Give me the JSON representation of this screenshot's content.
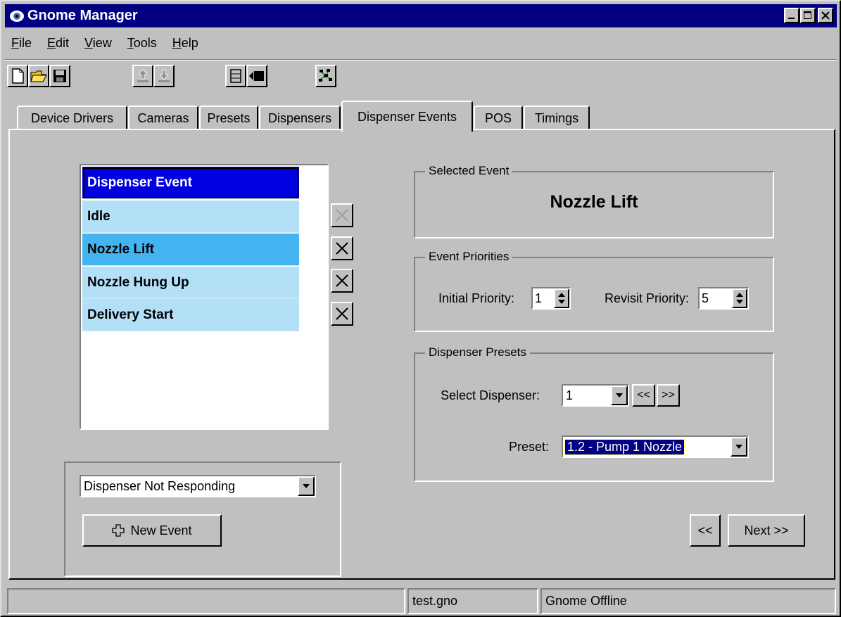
{
  "window": {
    "title": "Gnome Manager",
    "title_bar_color": "#000080"
  },
  "menu": [
    {
      "label": "File",
      "mnemonic": "F",
      "rest": "ile"
    },
    {
      "label": "Edit",
      "mnemonic": "E",
      "rest": "dit"
    },
    {
      "label": "View",
      "mnemonic": "V",
      "rest": "iew"
    },
    {
      "label": "Tools",
      "mnemonic": "T",
      "rest": "ools"
    },
    {
      "label": "Help",
      "mnemonic": "H",
      "rest": "elp"
    }
  ],
  "toolbar": {
    "icons": [
      "new-file-icon",
      "open-folder-icon",
      "save-icon",
      "upload-icon",
      "download-icon",
      "panel-icon",
      "camera-icon",
      "network-icon"
    ]
  },
  "tabs": [
    "Device Drivers",
    "Cameras",
    "Presets",
    "Dispensers",
    "Dispenser Events",
    "POS",
    "Timings"
  ],
  "active_tab": "Dispenser Events",
  "event_list": {
    "header": "Dispenser Event",
    "items": [
      "Idle",
      "Nozzle Lift",
      "Nozzle Hung Up",
      "Delivery Start"
    ],
    "selected": "Nozzle Lift",
    "colors": {
      "header": "#0000e0",
      "row": "#b4e0f7",
      "selected_row": "#44b4f0"
    }
  },
  "new_event": {
    "combo_value": "Dispenser Not Responding",
    "button_label": "New Event"
  },
  "selected_event": {
    "group_label": "Selected Event",
    "value": "Nozzle Lift"
  },
  "priorities": {
    "group_label": "Event Priorities",
    "initial_label": "Initial Priority:",
    "initial_value": "1",
    "revisit_label": "Revisit Priority:",
    "revisit_value": "5"
  },
  "presets": {
    "group_label": "Dispenser Presets",
    "dispenser_label": "Select Dispenser:",
    "dispenser_value": "1",
    "prev_label": "<<",
    "next_label": ">>",
    "preset_label": "Preset:",
    "preset_value": "1.2 - Pump 1 Nozzle"
  },
  "nav": {
    "back_label": "<<",
    "next_label": "Next >>"
  },
  "status": {
    "file": "test.gno",
    "state": "Gnome Offline"
  }
}
